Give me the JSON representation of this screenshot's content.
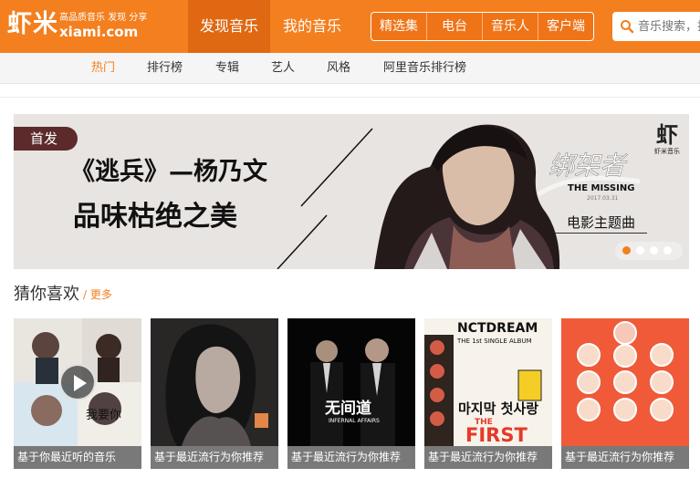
{
  "header": {
    "logo": "虾米",
    "slogan": "高品质音乐 发现 分享",
    "domain": "xiami.com",
    "main_nav": [
      "发现音乐",
      "我的音乐"
    ],
    "pill_nav": [
      "精选集",
      "电台",
      "音乐人",
      "客户端"
    ],
    "search_placeholder": "音乐搜索，找人..."
  },
  "sub_nav": [
    "热门",
    "排行榜",
    "专辑",
    "艺人",
    "风格",
    "阿里音乐排行榜"
  ],
  "banner": {
    "tag": "首发",
    "title": "《逃兵》—杨乃文",
    "subtitle": "品味枯绝之美",
    "logo_mark": "虾",
    "logo_text": "虾米音乐",
    "promo_title": "绑架者",
    "promo_subtitle": "THE MISSING",
    "promo_date": "2017.03.31",
    "theme_song": "电影主题曲",
    "active_dot": 0
  },
  "guess": {
    "title": "猜你喜欢",
    "more": "更多",
    "cards": [
      {
        "caption": "基于你最近听的音乐",
        "art": [
          "我要你"
        ],
        "playing": true
      },
      {
        "caption": "基于最近流行为你推荐",
        "art": []
      },
      {
        "caption": "基于最近流行为你推荐",
        "art": [
          "无间道",
          "INFERNAL AFFAIRS"
        ]
      },
      {
        "caption": "基于最近流行为你推荐",
        "art": [
          "NCTDREAM",
          "THE 1st SINGLE ALBUM",
          "마지막 첫사랑",
          "THE",
          "FIRST"
        ]
      },
      {
        "caption": "基于最近流行为你推荐",
        "art": []
      }
    ]
  },
  "colors": {
    "accent": "#f37f1f",
    "dark_accent": "#e06812",
    "caption_bg": "#4c4c4c"
  }
}
